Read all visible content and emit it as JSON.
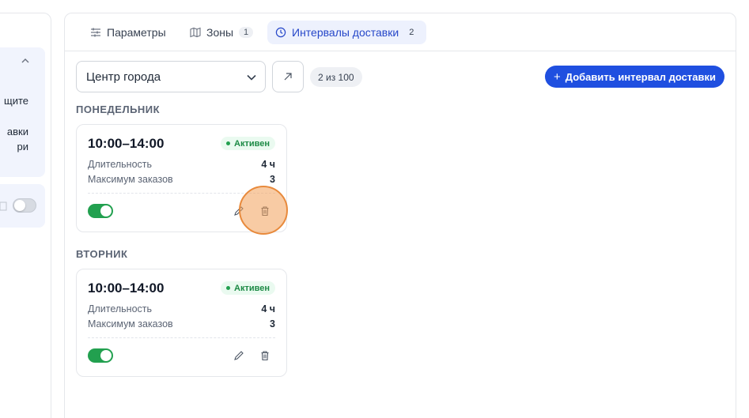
{
  "left_panel": {
    "lines": [
      "щите",
      "авки",
      "ри"
    ]
  },
  "tabs": [
    {
      "label": "Параметры",
      "icon": "sliders-icon",
      "count": null,
      "active": false
    },
    {
      "label": "Зоны",
      "icon": "map-icon",
      "count": "1",
      "active": false
    },
    {
      "label": "Интервалы доставки",
      "icon": "clock-icon",
      "count": "2",
      "active": true
    }
  ],
  "toolbar": {
    "zone_select_value": "Центр города",
    "counter": "2 из 100",
    "add_button_label": "Добавить интервал доставки"
  },
  "days": [
    {
      "label": "ПОНЕДЕЛЬНИК",
      "interval": {
        "time": "10:00–14:00",
        "status": "Активен",
        "duration_label": "Длительность",
        "duration_value": "4 ч",
        "max_orders_label": "Максимум заказов",
        "max_orders_value": "3",
        "enabled": true
      }
    },
    {
      "label": "ВТОРНИК",
      "interval": {
        "time": "10:00–14:00",
        "status": "Активен",
        "duration_label": "Длительность",
        "duration_value": "4 ч",
        "max_orders_label": "Максимум заказов",
        "max_orders_value": "3",
        "enabled": true
      }
    }
  ],
  "colors": {
    "accent": "#1f4fe0",
    "active_tab_bg": "#edf1fd",
    "status_green": "#22a04f",
    "click_highlight": "#e88a3c"
  }
}
